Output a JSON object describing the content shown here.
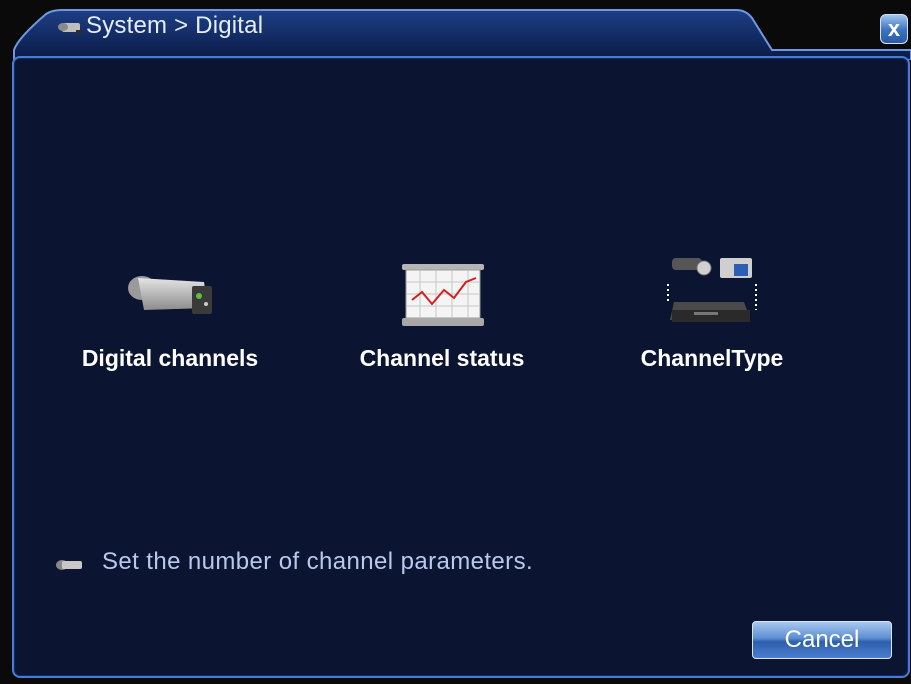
{
  "window": {
    "title": "System > Digital",
    "close_label": "x",
    "colors": {
      "panel_bg": "#0b1431",
      "border": "#4a7ad2",
      "accent": "#2e5fab"
    }
  },
  "menu": {
    "items": [
      {
        "label": "Digital channels",
        "icon": "ip-camera-icon"
      },
      {
        "label": "Channel status",
        "icon": "status-chart-icon"
      },
      {
        "label": "ChannelType",
        "icon": "channel-type-icon"
      }
    ]
  },
  "help": {
    "text": "Set the number of channel parameters.",
    "icon": "camera-hint-icon"
  },
  "footer": {
    "cancel_label": "Cancel"
  }
}
